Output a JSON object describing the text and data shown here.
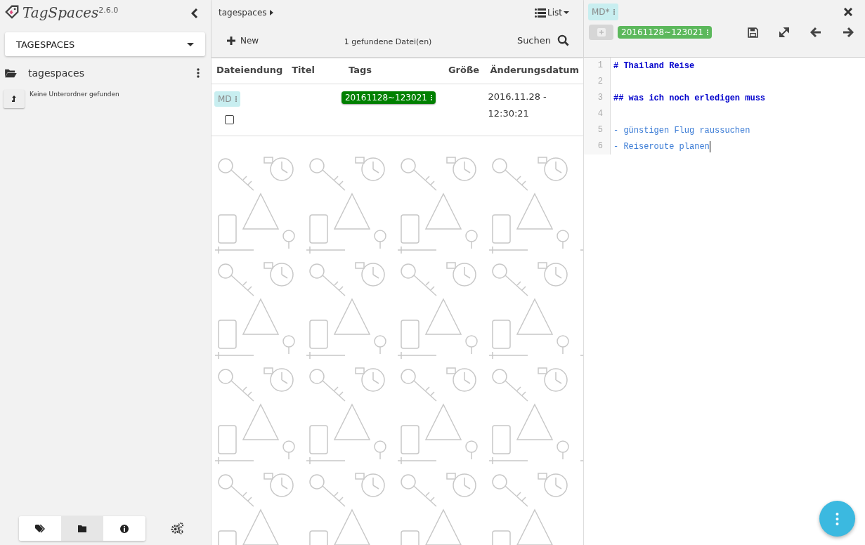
{
  "app": {
    "name": "TagSpaces",
    "version": "2.6.0"
  },
  "sidebar": {
    "location": "TAGESPACES",
    "folder": "tagespaces",
    "no_subfolders": "Keine Unterordner gefunden",
    "tabs": [
      {
        "kind": "tags",
        "selected": false
      },
      {
        "kind": "folder",
        "selected": true
      },
      {
        "kind": "info",
        "selected": false
      }
    ]
  },
  "file_list": {
    "breadcrumb": "tagespaces",
    "view": "List",
    "new_label": "New",
    "count": "1 gefundene Datei(en)",
    "search_label": "Suchen",
    "columns": [
      "Dateiendung",
      "Titel",
      "Tags",
      "Größe",
      "Änderungsdatum"
    ],
    "rows": [
      {
        "extension": "MD",
        "checked": false,
        "tags": [
          {
            "label": "20161128~123021",
            "color": "#008000"
          }
        ],
        "date": "2016.11.28 - 12:30:21"
      }
    ]
  },
  "editor": {
    "file_type": "MD*",
    "tags": [
      {
        "label": "20161128~123021",
        "color": "#5cb85c"
      }
    ],
    "lines": [
      {
        "number": "1",
        "kind": "heading",
        "text": "# Thailand Reise",
        "cursor": false
      },
      {
        "number": "2",
        "kind": "empty",
        "cursor": false
      },
      {
        "number": "3",
        "kind": "heading",
        "text": "## was ich noch erledigen muss",
        "cursor": false
      },
      {
        "number": "4",
        "kind": "empty",
        "cursor": false
      },
      {
        "number": "5",
        "kind": "list",
        "text": "- günstigen Flug raussuchen",
        "cursor": false
      },
      {
        "number": "6",
        "kind": "list",
        "text": "- Reiseroute planen",
        "cursor": true
      }
    ]
  }
}
